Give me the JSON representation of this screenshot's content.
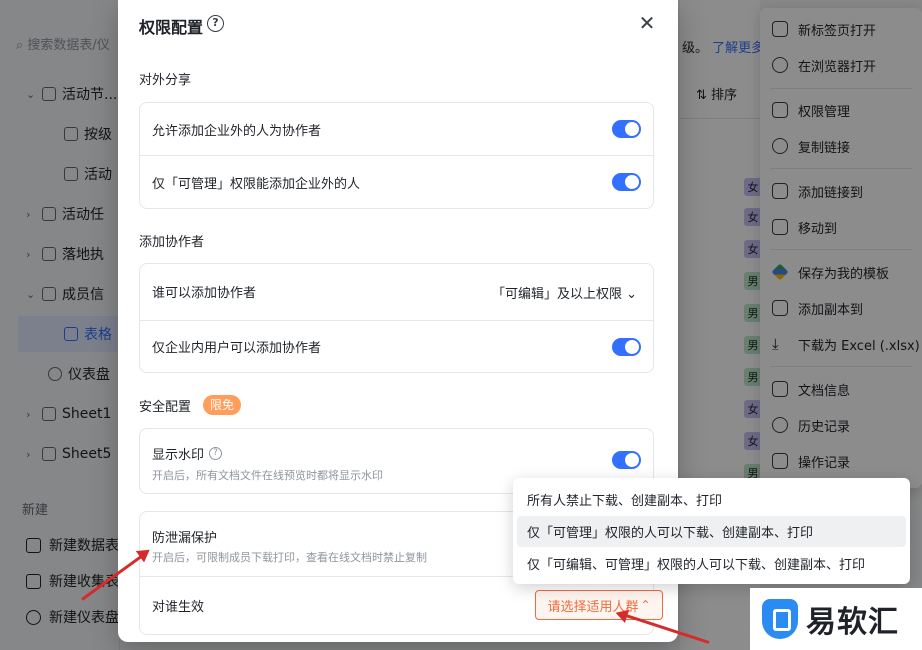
{
  "sidebar": {
    "search_placeholder": "搜索数据表/仪",
    "items": [
      {
        "label": "活动节..."
      },
      {
        "label": "按级"
      },
      {
        "label": "活动"
      },
      {
        "label": "活动任"
      },
      {
        "label": "落地执"
      },
      {
        "label": "成员信"
      },
      {
        "label": "表格"
      },
      {
        "label": "仪表盘"
      },
      {
        "label": "Sheet1"
      },
      {
        "label": "Sheet5"
      }
    ],
    "new_section": "新建",
    "new_items": [
      {
        "label": "新建数据表"
      },
      {
        "label": "新建收集表"
      },
      {
        "label": "新建仪表盘"
      }
    ]
  },
  "background": {
    "learn_more": "了解更多",
    "notice_tail": "级。",
    "sort_label": "排序",
    "tags": [
      "女",
      "女",
      "女",
      "男",
      "男",
      "男",
      "男",
      "女",
      "女",
      "男"
    ]
  },
  "context_menu": {
    "items": [
      {
        "label": "新标签页打开"
      },
      {
        "label": "在浏览器打开"
      },
      {
        "label": "权限管理"
      },
      {
        "label": "复制链接"
      },
      {
        "label": "添加链接到"
      },
      {
        "label": "移动到"
      },
      {
        "label": "保存为我的模板"
      },
      {
        "label": "添加副本到"
      },
      {
        "label": "下载为 Excel (.xlsx)"
      },
      {
        "label": "文档信息"
      },
      {
        "label": "历史记录"
      },
      {
        "label": "操作记录"
      }
    ]
  },
  "dialog": {
    "title": "权限配置",
    "external_share": {
      "heading": "对外分享",
      "allow_external": "允许添加企业外的人为协作者",
      "only_manage": "仅「可管理」权限能添加企业外的人"
    },
    "add_collaborator": {
      "heading": "添加协作者",
      "who_can_add": "谁可以添加协作者",
      "who_can_add_value": "「可编辑」及以上权限",
      "internal_only": "仅企业内用户可以添加协作者"
    },
    "security": {
      "heading": "安全配置",
      "badge": "限免",
      "watermark": "显示水印",
      "watermark_desc": "开启后，所有文档文件在线预览时都将显示水印",
      "leak_protect": "防泄漏保护",
      "leak_desc": "开启后，可限制成员下载打印，查看在线文档时禁止复制",
      "applies_to": "对谁生效",
      "applies_to_placeholder": "请选择适用人群"
    }
  },
  "dropdown": {
    "options": [
      {
        "label": "所有人禁止下载、创建副本、打印"
      },
      {
        "label": "仅「可管理」权限的人可以下载、创建副本、打印"
      },
      {
        "label": "仅「可编辑、可管理」权限的人可以下载、创建副本、打印"
      }
    ]
  },
  "logo": {
    "text": "易软汇"
  },
  "colors": {
    "accent": "#3370ff",
    "warn": "#f26b3a",
    "badge": "#ff9d5c",
    "arrow": "#d62b2b"
  }
}
